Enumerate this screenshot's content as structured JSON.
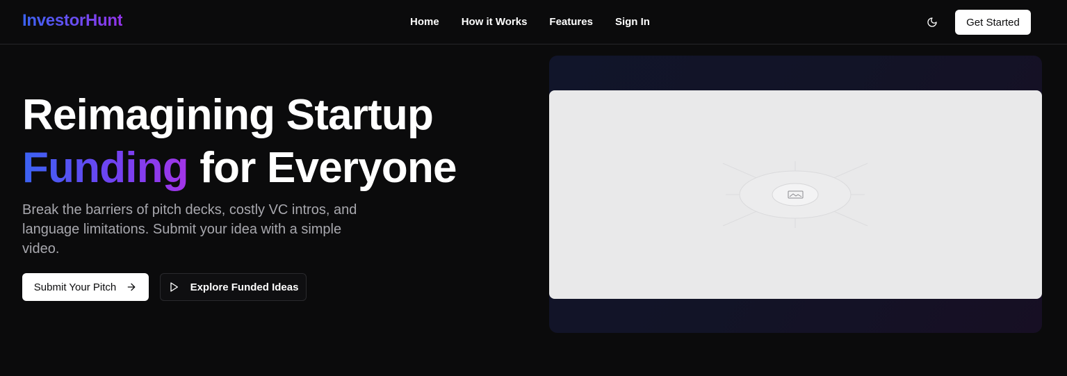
{
  "header": {
    "logo": "InvestorHunt",
    "nav": [
      "Home",
      "How it Works",
      "Features",
      "Sign In"
    ],
    "theme_icon": "moon-icon",
    "cta_label": "Get Started"
  },
  "hero": {
    "headline_line1": "Reimagining Startup",
    "headline_accent": "Funding",
    "headline_rest": " for Everyone",
    "subtitle": "Break the barriers of pitch decks, costly VC intros, and language limitations. Submit your idea with a simple video.",
    "primary_button": "Submit Your Pitch",
    "primary_icon": "arrow-right-icon",
    "secondary_button": "Explore Funded Ideas",
    "secondary_icon": "play-icon"
  },
  "media": {
    "placeholder_icon": "image-placeholder-icon"
  },
  "colors": {
    "background": "#0b0b0c",
    "accent_start": "#3b63f3",
    "accent_end": "#9333ea",
    "panel": "#e9e9ea"
  }
}
